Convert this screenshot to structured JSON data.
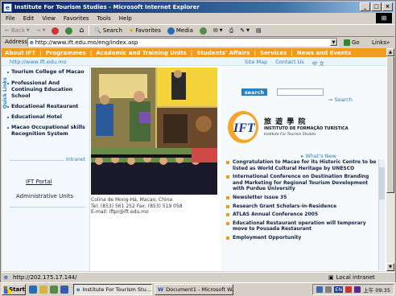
{
  "window": {
    "title": "Institute For Tourism Studies - Microsoft Internet Explorer",
    "icon": "ie-icon"
  },
  "menu": [
    "File",
    "Edit",
    "View",
    "Favorites",
    "Tools",
    "Help"
  ],
  "toolbar": {
    "back": "Back",
    "search": "Search",
    "favorites": "Favorites",
    "media": "Media"
  },
  "address": {
    "label": "Address",
    "url": "http://www.ift.edu.mo/eng/index.asp",
    "go": "Go",
    "links": "Links"
  },
  "site": {
    "nav": [
      "About IFT",
      "Programmes",
      "Academic and Training Units",
      "Students' Affairs",
      "Services",
      "News and Events"
    ],
    "url_text": "http://www.ift.edu.mo",
    "top_links": [
      "Site Map",
      "Contact Us",
      "中 文"
    ],
    "quick_links": "Quick Links",
    "sidebar_items": [
      "Tourism College of Macao",
      "Professional And Continuing Education School",
      "Educational Restaurant",
      "Educational Hotel",
      "Macao Occupational skills Recognition System"
    ],
    "intranet": "Intranet",
    "portal": "IFT Portal",
    "admin": "Administrative Units",
    "contact_lines": [
      "Colina de Mong-Há, Macao, China",
      "Tel: (853) 561 252     Fax: (853) 519 058",
      "E-mail:  iftpr@ift.edu.mo"
    ],
    "search_button": "search",
    "search_link": "Search",
    "logo_chinese": "旅 遊 學 院",
    "logo_portuguese": "INSTITUTO DE FORMAÇÃO TURÍSTICA",
    "logo_english": "Institute For Tourism Studies",
    "whats_new": "What's New",
    "news": [
      "Congratulation to Macao for its Historic Centre to be listed as World Cultural Heritage by UNESCO",
      "International Conference on Destination Branding and Marketing for Regional Tourism Development with Purdue University",
      "Newsletter Issue 35",
      "Research Grant Scholars-in-Residence",
      "ATLAS Annual Conference 2005",
      "Educational Restaurant operation will temporary move to Pousada Restaurant",
      "Employment Opportunity"
    ]
  },
  "status": {
    "text": "http://202.175.17.144/",
    "zone": "Local intranet"
  },
  "taskbar": {
    "start": "Start",
    "tasks": [
      "Institute For Tourism Stu...",
      "Document1 - Microsoft W..."
    ],
    "lang": "EN",
    "clock": "上午 09:35"
  },
  "colors": {
    "nav_orange": "#f49a1a",
    "link_blue": "#2a7fc0",
    "title_blue": "#0a246a"
  }
}
